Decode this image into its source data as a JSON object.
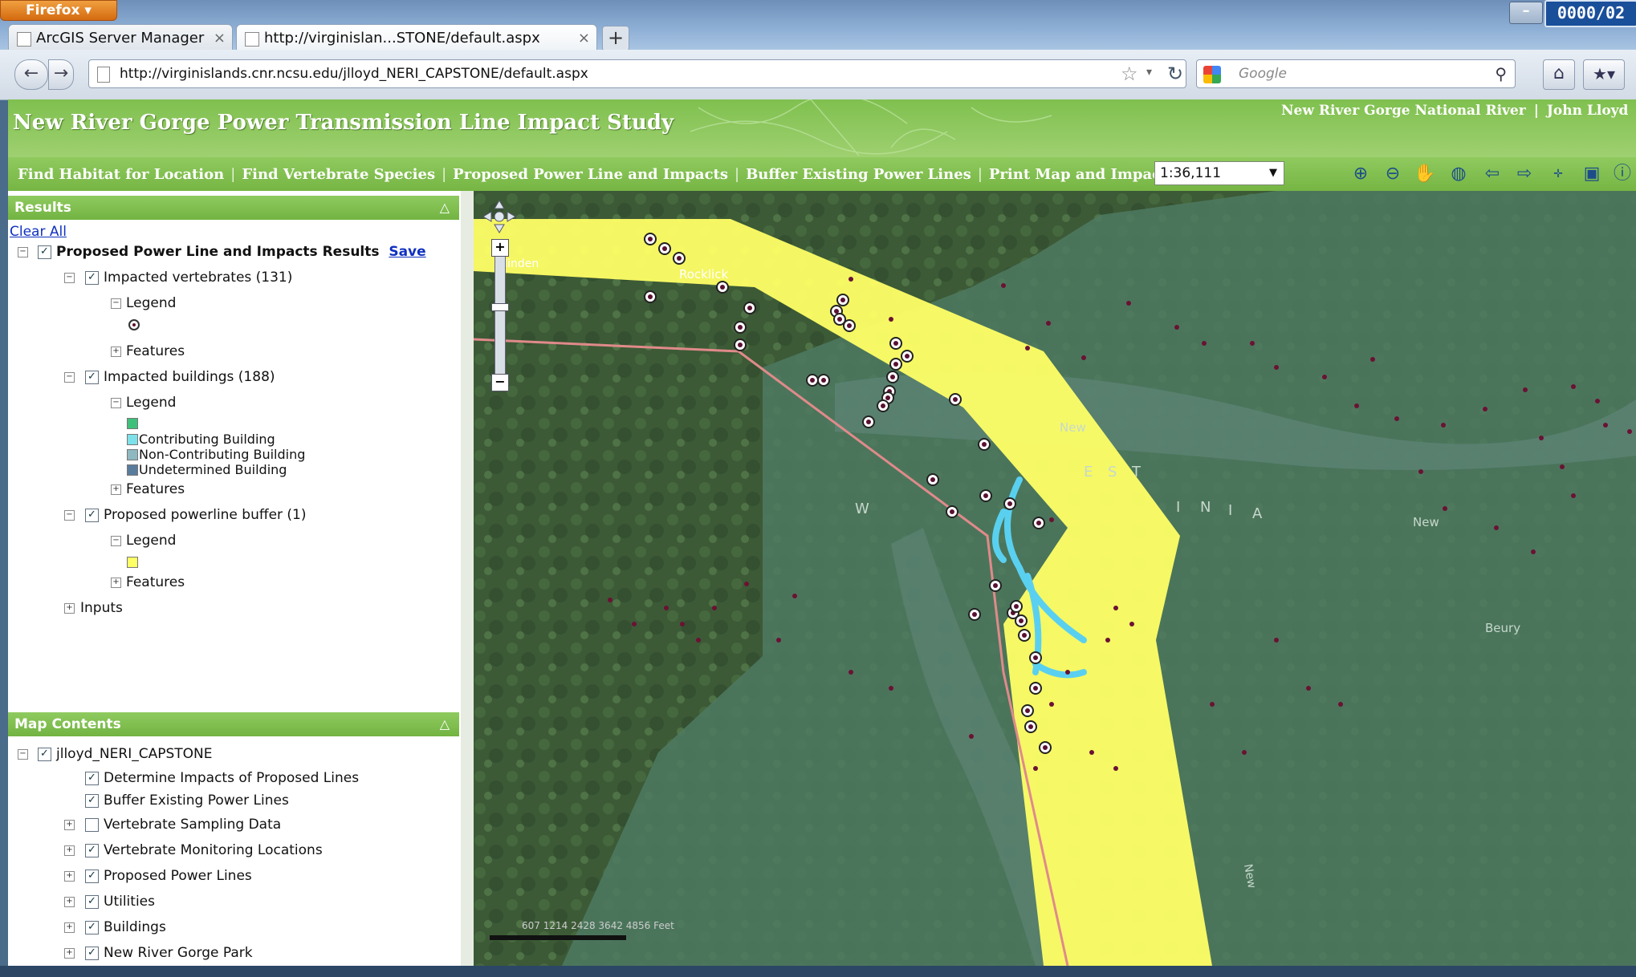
{
  "browser": {
    "menu_button": "Firefox",
    "tabs": [
      {
        "label": "ArcGIS Server Manager"
      },
      {
        "label": "http://virginislan...STONE/default.aspx"
      }
    ],
    "new_tab_label": "+",
    "url": "http://virginislands.cnr.ncsu.edu/jlloyd_NERI_CAPSTONE/default.aspx",
    "search_placeholder": "Google",
    "clock": "0000/02"
  },
  "app": {
    "title": "New River Gorge Power Transmission Line Impact Study",
    "top_links": [
      "New River Gorge National River",
      "John Lloyd"
    ],
    "nav": [
      "Find Habitat for Location",
      "Find Vertebrate Species",
      "Proposed Power Line and Impacts",
      "Buffer Existing Power Lines",
      "Print Map and Impacts"
    ],
    "scale": "1:36,111",
    "toolbar_icons": [
      "zoom-in-icon",
      "zoom-out-icon",
      "pan-icon",
      "full-extent-icon",
      "back-icon",
      "forward-icon",
      "xy-icon",
      "identify-icon",
      "info-icon"
    ]
  },
  "results": {
    "header": "Results",
    "clear_all": "Clear All",
    "root_label": "Proposed Power Line and Impacts Results",
    "save_label": "Save",
    "groups": [
      {
        "label": "Impacted vertebrates (131)",
        "legend": "Legend",
        "features": "Features"
      },
      {
        "label": "Impacted buildings (188)",
        "legend": "Legend",
        "features": "Features",
        "legend_items": [
          "Contributing Building",
          "Non-Contributing Building",
          "Undetermined Building"
        ]
      },
      {
        "label": "Proposed powerline buffer (1)",
        "legend": "Legend",
        "features": "Features"
      }
    ],
    "inputs_label": "Inputs"
  },
  "map_contents": {
    "header": "Map Contents",
    "root_label": "jlloyd_NERI_CAPSTONE",
    "layers": [
      {
        "label": "Determine Impacts of Proposed Lines",
        "checked": true
      },
      {
        "label": "Buffer Existing Power Lines",
        "checked": true
      },
      {
        "label": "Vertebrate Sampling Data",
        "checked": false
      },
      {
        "label": "Vertebrate Monitoring Locations",
        "checked": true
      },
      {
        "label": "Proposed Power Lines",
        "checked": true
      },
      {
        "label": "Utilities",
        "checked": true
      },
      {
        "label": "Buildings",
        "checked": true
      },
      {
        "label": "New River Gorge Park",
        "checked": true
      }
    ]
  },
  "map": {
    "place_labels": [
      "Rocklick",
      "Minden",
      "New",
      "New",
      "W",
      "E",
      "S",
      "T",
      "I",
      "N",
      "I",
      "A",
      "Beury",
      "New"
    ],
    "scale_bar_text": "607  1214   2428    3642    4856 Feet",
    "colors": {
      "buffer": "#ffff66",
      "park": "#4e7a62",
      "powerline": "#e08a8a",
      "water": "#5ad0f0",
      "point": "#5a1030"
    }
  }
}
